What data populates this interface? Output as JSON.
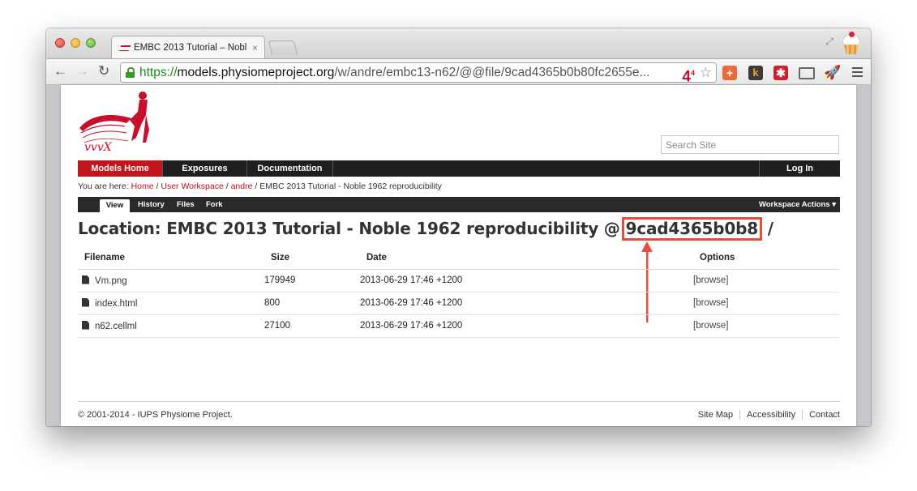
{
  "browser": {
    "tab_title": "EMBC 2013 Tutorial – Nobl",
    "tab_close": "×",
    "url_scheme": "https://",
    "url_host": "models.physiomeproject.org",
    "url_path": "/w/andre/embc13-n62/@@file/9cad4365b0b80fc2655e...",
    "omnibox_ext_label": "4",
    "omnibox_ext_badge": "4"
  },
  "site": {
    "search_placeholder": "Search Site",
    "nav": {
      "models_home": "Models Home",
      "exposures": "Exposures",
      "documentation": "Documentation",
      "login": "Log In"
    },
    "breadcrumb": {
      "prefix": "You are here:",
      "home": "Home",
      "user_workspace": "User Workspace",
      "andre": "andre",
      "current": "EMBC 2013 Tutorial - Noble 1962 reproducibility",
      "separator": "/"
    },
    "content_tabs": {
      "view": "View",
      "history": "History",
      "files": "Files",
      "fork": "Fork",
      "workspace_actions": "Workspace Actions ▾"
    },
    "location": {
      "prefix": "Location: EMBC 2013 Tutorial - Noble 1962 reproducibility @",
      "hash": "9cad4365b0b8",
      "suffix": "/"
    },
    "table": {
      "headers": [
        "Filename",
        "Size",
        "Date",
        "Options"
      ],
      "rows": [
        {
          "filename": "Vm.png",
          "size": "179949",
          "date": "2013-06-29 17:46 +1200",
          "option": "[browse]"
        },
        {
          "filename": "index.html",
          "size": "800",
          "date": "2013-06-29 17:46 +1200",
          "option": "[browse]"
        },
        {
          "filename": "n62.cellml",
          "size": "27100",
          "date": "2013-06-29 17:46 +1200",
          "option": "[browse]"
        }
      ]
    },
    "footer": {
      "copyright": "© 2001-2014 - IUPS Physiome Project.",
      "links": [
        "Site Map",
        "Accessibility",
        "Contact"
      ]
    }
  },
  "colors": {
    "brand_red": "#c0161c",
    "annotation_red": "#e84c3d",
    "nav_dark": "#1f1f1f"
  }
}
